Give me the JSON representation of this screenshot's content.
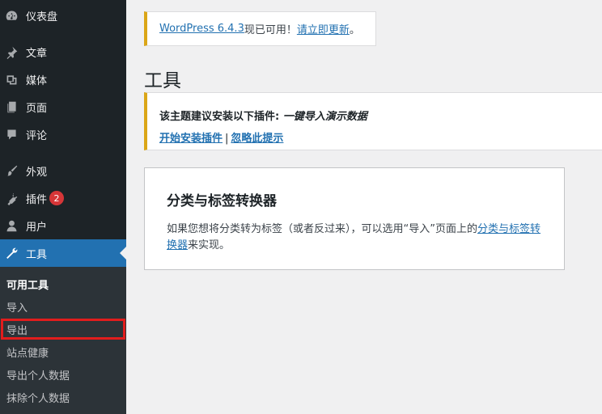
{
  "sidebar": {
    "items": [
      {
        "label": "仪表盘",
        "icon": "dashboard-icon"
      },
      {
        "label": "文章",
        "icon": "pin-icon"
      },
      {
        "label": "媒体",
        "icon": "media-icon"
      },
      {
        "label": "页面",
        "icon": "page-icon"
      },
      {
        "label": "评论",
        "icon": "comment-icon"
      },
      {
        "label": "外观",
        "icon": "brush-icon"
      },
      {
        "label": "插件",
        "icon": "plugin-icon",
        "badge": "2"
      },
      {
        "label": "用户",
        "icon": "user-icon"
      },
      {
        "label": "工具",
        "icon": "wrench-icon",
        "active": true
      }
    ],
    "submenu": [
      {
        "label": "可用工具"
      },
      {
        "label": "导入"
      },
      {
        "label": "导出"
      },
      {
        "label": "站点健康"
      },
      {
        "label": "导出个人数据"
      },
      {
        "label": "抹除个人数据"
      }
    ]
  },
  "update_notice": {
    "version_link": "WordPress 6.4.3",
    "middle_text": "现已可用！",
    "update_link": "请立即更新",
    "end": "。"
  },
  "page_title": "工具",
  "plugin_notice": {
    "text": "该主题建议安装以下插件: ",
    "plugin_name": "一键导入演示数据",
    "install_link": "开始安装插件",
    "separator": "|",
    "dismiss_link": "忽略此提示"
  },
  "card": {
    "title": "分类与标签转换器",
    "desc_before": "如果您想将分类转为标签（或者反过来），可以选用“导入”页面上的",
    "desc_link": "分类与标签转换器",
    "desc_after": "来实现。"
  },
  "colors": {
    "sidebar_bg": "#1d2327",
    "active_bg": "#2271b1",
    "notice_border": "#dba617",
    "badge_bg": "#d63638",
    "highlight": "#e11d1d"
  }
}
